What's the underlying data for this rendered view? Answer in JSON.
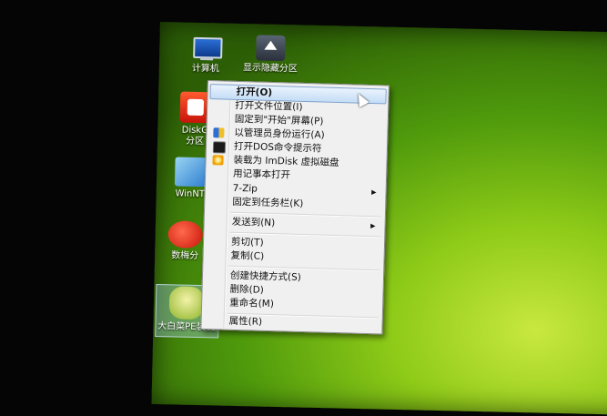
{
  "desktop": {
    "icons": [
      {
        "id": "computer",
        "label": "计算机",
        "icon": "computer-icon"
      },
      {
        "id": "show-hidden",
        "label": "显示隐藏分区",
        "icon": "drive-icon"
      },
      {
        "id": "diskgenius",
        "label": "DiskG\n分区",
        "icon": "diskgenius-icon"
      },
      {
        "id": "winnt",
        "label": "WinNT",
        "icon": "windows-setup-icon"
      },
      {
        "id": "yu",
        "label": "数梅分",
        "icon": "partition-tool-icon"
      },
      {
        "id": "selected",
        "label": "大白菜PE装机",
        "icon": "cabbage-icon"
      }
    ]
  },
  "context_menu": {
    "items": [
      {
        "label": "打开(O)",
        "highlighted": true
      },
      {
        "label": "打开文件位置(I)"
      },
      {
        "label": "固定到\"开始\"屏幕(P)"
      },
      {
        "label": "以管理员身份运行(A)",
        "icon": "shield-icon"
      },
      {
        "label": "打开DOS命令提示符",
        "icon": "cmd-icon"
      },
      {
        "label": "装载为 ImDisk 虚拟磁盘",
        "icon": "disc-icon"
      },
      {
        "label": "用记事本打开"
      },
      {
        "label": "7-Zip",
        "submenu": true
      },
      {
        "label": "固定到任务栏(K)"
      },
      {
        "label": "发送到(N)",
        "submenu": true
      },
      {
        "label": "剪切(T)"
      },
      {
        "label": "复制(C)"
      },
      {
        "label": "创建快捷方式(S)"
      },
      {
        "label": "删除(D)"
      },
      {
        "label": "重命名(M)"
      },
      {
        "label": "属性(R)"
      }
    ]
  },
  "colors": {
    "highlight": "#c4ddf6",
    "menu_bg": "#f0f0f0",
    "desktop_green": "#8fcb18"
  }
}
